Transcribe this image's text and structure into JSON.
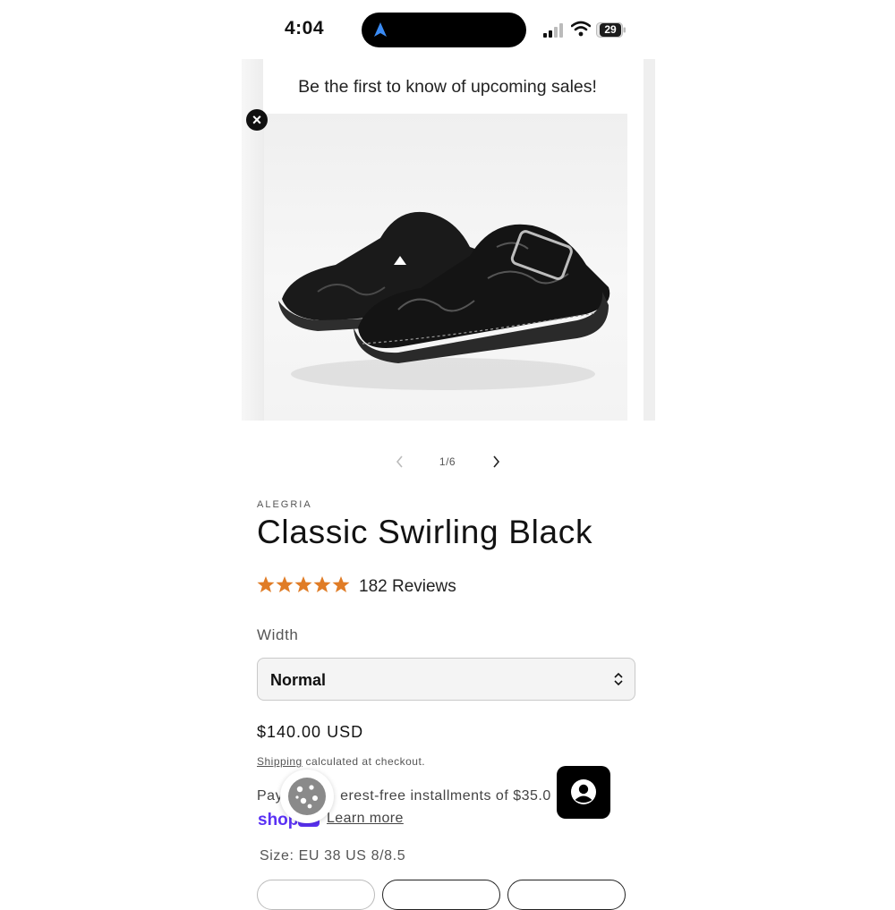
{
  "status_bar": {
    "time": "4:04",
    "battery": "29",
    "icons": [
      "location-arrow-icon",
      "cellular-signal-icon",
      "wifi-icon",
      "battery-icon"
    ]
  },
  "popup": {
    "text": "Be the first to know of upcoming sales!",
    "close_icon": "close-circle-icon"
  },
  "gallery": {
    "counter": "1/6",
    "prev_icon": "chevron-left-icon",
    "next_icon": "chevron-right-icon"
  },
  "product": {
    "vendor": "ALEGRIA",
    "title": "Classic Swirling Black",
    "rating_stars": 5,
    "reviews": "182 Reviews",
    "width_label": "Width",
    "width_value": "Normal",
    "price": "$140.00 USD",
    "shipping_link": "Shipping",
    "shipping_rest": " calculated at checkout.",
    "pay_prefix": "Pay",
    "pay_suffix": "erest-free installments of $35.0",
    "learn_more": "Learn more",
    "size_label": "Size: EU 38 US 8/8.5"
  },
  "colors": {
    "star": "#e07c26",
    "shop_pay": "#5a31f4",
    "account_button": "#000000"
  },
  "floating": {
    "cookie_icon": "cookie-icon",
    "account_icon": "account-icon"
  }
}
